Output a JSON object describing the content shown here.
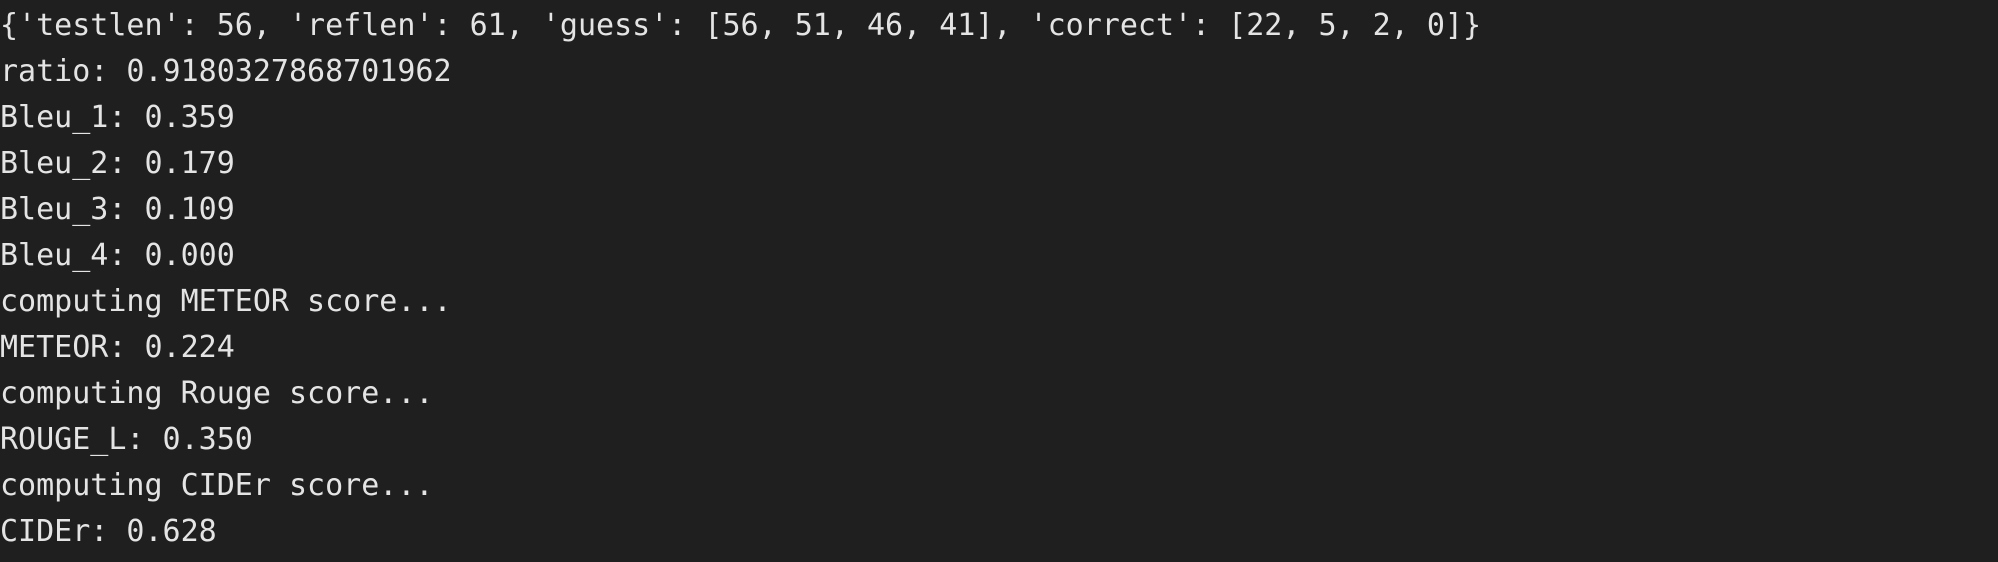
{
  "terminal": {
    "lines": [
      "{'testlen': 56, 'reflen': 61, 'guess': [56, 51, 46, 41], 'correct': [22, 5, 2, 0]}",
      "ratio: 0.9180327868701962",
      "Bleu_1: 0.359",
      "Bleu_2: 0.179",
      "Bleu_3: 0.109",
      "Bleu_4: 0.000",
      "computing METEOR score...",
      "METEOR: 0.224",
      "computing Rouge score...",
      "ROUGE_L: 0.350",
      "computing CIDEr score...",
      "CIDEr: 0.628"
    ]
  },
  "colors": {
    "background": "#1f1f1f",
    "text": "#e4e4e4"
  }
}
